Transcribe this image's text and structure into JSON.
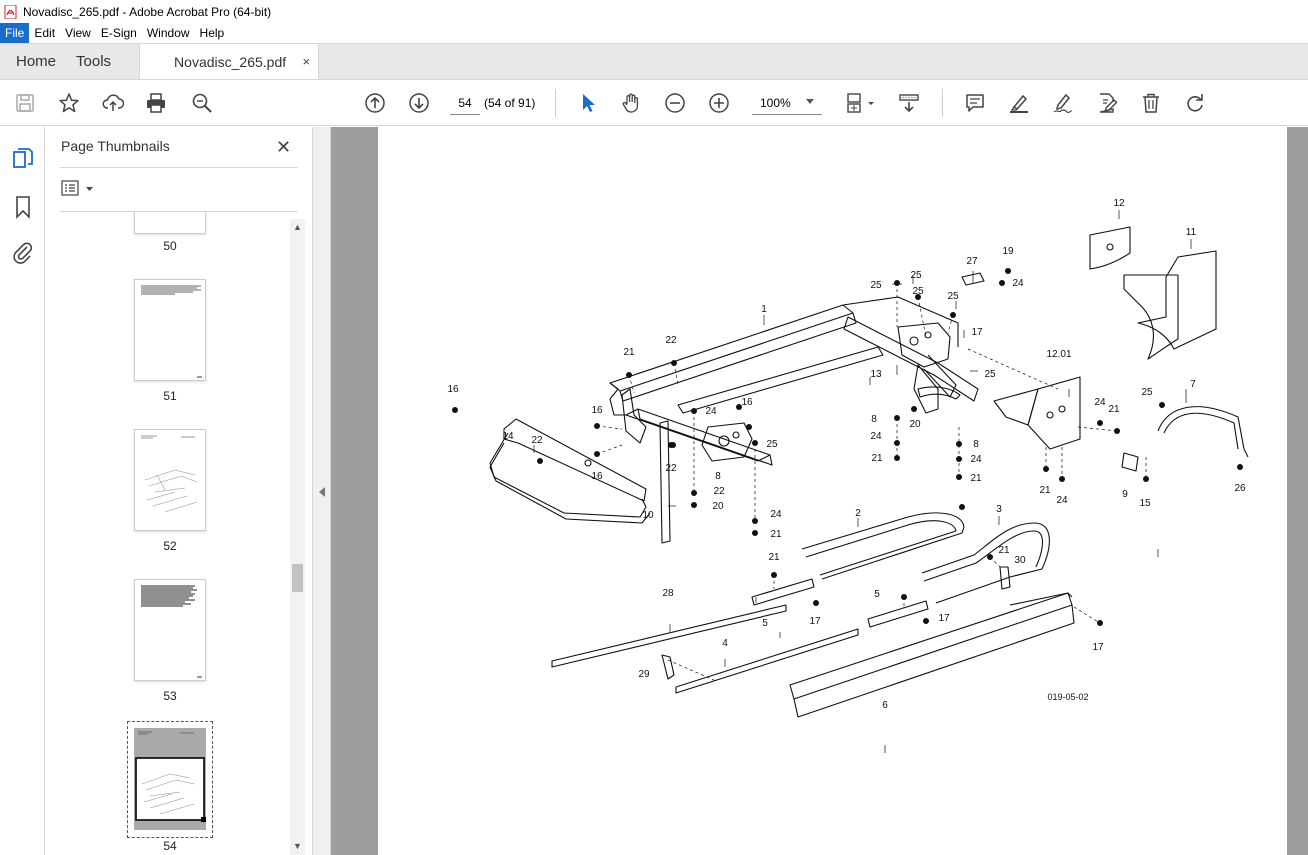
{
  "window": {
    "title": "Novadisc_265.pdf - Adobe Acrobat Pro (64-bit)"
  },
  "menu": [
    "File",
    "Edit",
    "View",
    "E-Sign",
    "Window",
    "Help"
  ],
  "tabs": {
    "home": "Home",
    "tools": "Tools",
    "document": "Novadisc_265.pdf",
    "close": "×"
  },
  "toolbar": {
    "page_number": "54",
    "page_count": "(54 of 91)",
    "zoom": "100%",
    "icons": [
      "save-icon",
      "bookmark-star-icon",
      "upload-icon",
      "print-icon",
      "search-zoom-icon",
      "page-up-icon",
      "page-down-icon",
      "select-cursor-icon",
      "hand-icon",
      "zoom-out-icon",
      "zoom-in-icon",
      "fit-page-icon",
      "scroll-mode-icon",
      "comment-icon",
      "highlight-icon",
      "sign-icon",
      "edit-pdf-icon",
      "delete-icon",
      "rotate-icon"
    ]
  },
  "panel": {
    "title": "Page Thumbnails",
    "close": "✕",
    "thumbnails": [
      {
        "label": "50"
      },
      {
        "label": "51"
      },
      {
        "label": "52"
      },
      {
        "label": "53"
      },
      {
        "label": "54",
        "selected": true
      }
    ]
  },
  "drawing": {
    "code": "019-05-02",
    "callouts": [
      "1",
      "2",
      "3",
      "4",
      "5",
      "5",
      "6",
      "7",
      "8",
      "8",
      "8",
      "9",
      "10",
      "11",
      "12",
      "12.01",
      "13",
      "14",
      "15",
      "16",
      "16",
      "16",
      "16",
      "17",
      "17",
      "17",
      "17",
      "19",
      "20",
      "20",
      "21",
      "21",
      "21",
      "21",
      "21",
      "21",
      "21",
      "21",
      "22",
      "22",
      "22",
      "22",
      "24",
      "24",
      "24",
      "24",
      "24",
      "24",
      "24",
      "25",
      "25",
      "25",
      "25",
      "25",
      "25",
      "25",
      "26",
      "27",
      "28",
      "29",
      "30",
      "30"
    ]
  }
}
